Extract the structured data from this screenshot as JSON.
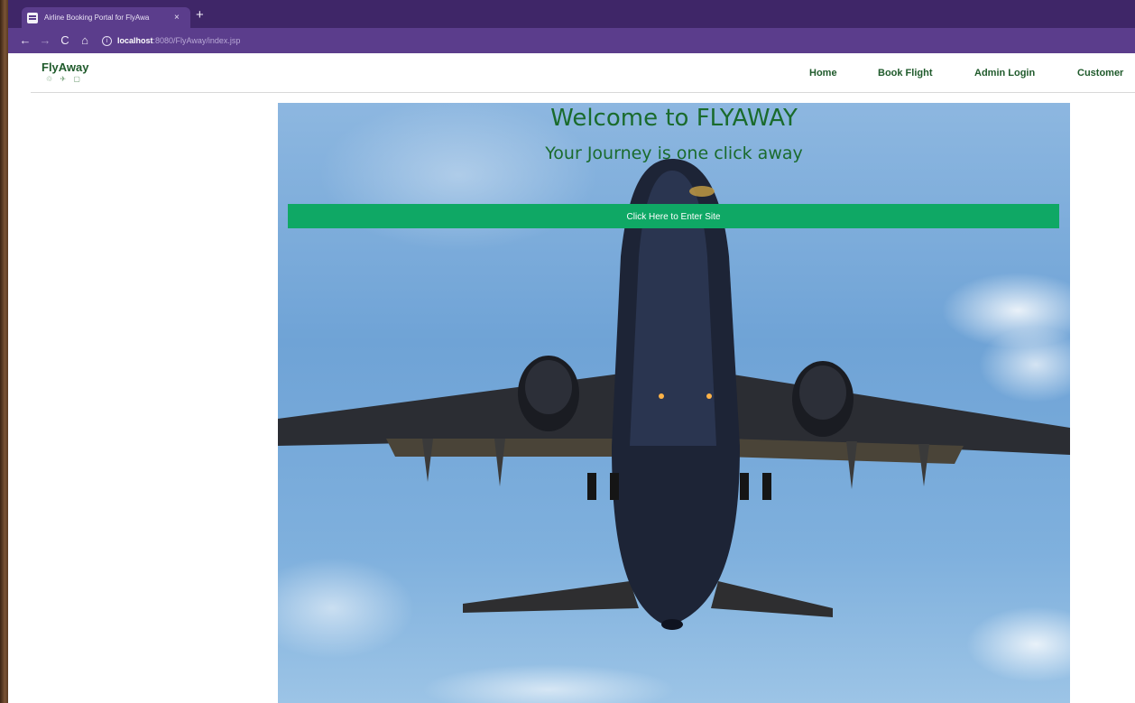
{
  "browser": {
    "tab_title": "Airline Booking Portal for FlyAwa",
    "tab_close": "×",
    "new_tab": "+",
    "back": "←",
    "forward": "→",
    "reload": "C",
    "home": "⌂",
    "info": "i",
    "url_host": "localhost",
    "url_rest": ":8080/FlyAway/index.jsp",
    "theme_color": "#5b3d8c"
  },
  "navbar": {
    "brand": "FlyAway",
    "brand_icons": "♲ ✈ ▢",
    "links": [
      "Home",
      "Book Flight",
      "Admin Login",
      "Customer"
    ],
    "link_color": "#1f5a2b"
  },
  "hero": {
    "title": "Welcome to FLYAWAY",
    "subtitle": "Your Journey is one click away",
    "enter_button": "Click Here to Enter Site",
    "button_color": "#0fa865",
    "text_color": "#1a6b2d",
    "image": "airplane-underside-photo"
  }
}
